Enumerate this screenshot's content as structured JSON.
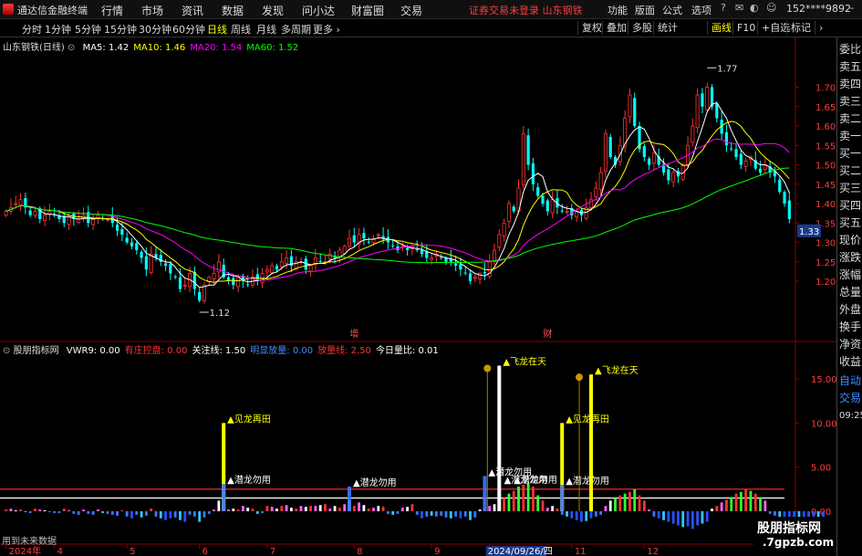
{
  "app": {
    "brand": "通达信金融终端",
    "menu": [
      "行情",
      "市场",
      "资讯",
      "数据",
      "发现",
      "问小达",
      "财富圈",
      "交易"
    ],
    "trade_warning": "证券交易未登录",
    "stock_title": "山东钢铁",
    "top_right": [
      "功能",
      "版面",
      "公式",
      "选项"
    ],
    "user": "152****9892"
  },
  "toolbar": {
    "periods": [
      "分时",
      "1分钟",
      "5分钟",
      "15分钟",
      "30分钟",
      "60分钟",
      "日线",
      "周线",
      "月线",
      "多周期",
      "更多"
    ],
    "active_period": "日线",
    "right_buttons": [
      "复权",
      "叠加",
      "多股",
      "统计",
      "画线",
      "F10",
      "+自选",
      "标记"
    ],
    "active_right": "画线"
  },
  "side_panel": {
    "items": [
      "委比",
      "卖五",
      "卖四",
      "卖三",
      "卖二",
      "卖一",
      "买一",
      "买二",
      "买三",
      "买四",
      "买五",
      "现价",
      "涨跌",
      "涨幅",
      "总量",
      "外盘",
      "换手",
      "净资",
      "收益"
    ],
    "extra": [
      "自动",
      "交易"
    ],
    "time": "09:25"
  },
  "main_legend": {
    "name": "山东钢铁(日线)",
    "items": [
      {
        "text": "MA5: 1.42",
        "color": "#ffffff"
      },
      {
        "text": "MA10: 1.46",
        "color": "#ffff00"
      },
      {
        "text": "MA20: 1.54",
        "color": "#ff00ff"
      },
      {
        "text": "MA60: 1.52",
        "color": "#00ff00"
      }
    ]
  },
  "indicator_legend": {
    "name": "股朋指标网",
    "items": [
      {
        "text": "VWR9: 0.00",
        "color": "#ffffff"
      },
      {
        "text": "有庄控盘: 0.00",
        "color": "#ff3232"
      },
      {
        "text": "关注线: 1.50",
        "color": "#ffffff"
      },
      {
        "text": "明显放量: 0.00",
        "color": "#3c8cff"
      },
      {
        "text": "放量线: 2.50",
        "color": "#ff3232"
      },
      {
        "text": "今日量比: 0.01",
        "color": "#ffffff"
      }
    ]
  },
  "chart_data": [
    {
      "type": "candlestick",
      "title": "山东钢铁(日线)",
      "y_ticks": [
        1.2,
        1.25,
        1.3,
        1.35,
        1.4,
        1.45,
        1.5,
        1.55,
        1.6,
        1.65,
        1.7
      ],
      "ylim": [
        1.08,
        1.8
      ],
      "current_price": "1.33",
      "max_label": "1.77",
      "min_label": "1.12",
      "markers": [
        {
          "text": "增",
          "at_index": 72
        },
        {
          "text": "财",
          "at_index": 112
        }
      ],
      "close": [
        1.38,
        1.39,
        1.4,
        1.41,
        1.39,
        1.37,
        1.38,
        1.36,
        1.37,
        1.38,
        1.37,
        1.36,
        1.35,
        1.37,
        1.36,
        1.36,
        1.37,
        1.35,
        1.36,
        1.37,
        1.36,
        1.36,
        1.35,
        1.33,
        1.32,
        1.3,
        1.29,
        1.28,
        1.26,
        1.23,
        1.27,
        1.26,
        1.25,
        1.24,
        1.22,
        1.21,
        1.18,
        1.19,
        1.22,
        1.18,
        1.15,
        1.19,
        1.21,
        1.22,
        1.25,
        1.21,
        1.2,
        1.19,
        1.21,
        1.2,
        1.19,
        1.21,
        1.2,
        1.22,
        1.23,
        1.24,
        1.23,
        1.25,
        1.26,
        1.24,
        1.25,
        1.25,
        1.23,
        1.24,
        1.26,
        1.25,
        1.25,
        1.27,
        1.26,
        1.28,
        1.29,
        1.31,
        1.3,
        1.32,
        1.31,
        1.3,
        1.31,
        1.32,
        1.31,
        1.3,
        1.29,
        1.28,
        1.29,
        1.28,
        1.29,
        1.28,
        1.27,
        1.26,
        1.26,
        1.27,
        1.26,
        1.25,
        1.25,
        1.24,
        1.23,
        1.22,
        1.2,
        1.21,
        1.22,
        1.22,
        1.25,
        1.28,
        1.32,
        1.35,
        1.4,
        1.38,
        1.44,
        1.58,
        1.5,
        1.45,
        1.42,
        1.4,
        1.38,
        1.41,
        1.39,
        1.38,
        1.38,
        1.37,
        1.38,
        1.37,
        1.39,
        1.41,
        1.44,
        1.48,
        1.58,
        1.52,
        1.5,
        1.55,
        1.62,
        1.68,
        1.6,
        1.54,
        1.52,
        1.5,
        1.53,
        1.5,
        1.48,
        1.46,
        1.48,
        1.47,
        1.5,
        1.55,
        1.6,
        1.68,
        1.65,
        1.7,
        1.65,
        1.62,
        1.58,
        1.55,
        1.54,
        1.52,
        1.5,
        1.51,
        1.52,
        1.49,
        1.48,
        1.5,
        1.48,
        1.47,
        1.43,
        1.4,
        1.36
      ],
      "series": [
        {
          "name": "MA5",
          "color": "#ffffff"
        },
        {
          "name": "MA10",
          "color": "#ffff00"
        },
        {
          "name": "MA20",
          "color": "#ff00ff"
        },
        {
          "name": "MA60",
          "color": "#00ff00"
        }
      ]
    },
    {
      "type": "bar",
      "title": "股朋指标网",
      "y_ticks": [
        0.0,
        5.0,
        10.0,
        15.0
      ],
      "ylim": [
        -3,
        18
      ],
      "ref_lines": [
        {
          "value": 1.5,
          "color": "#ffffff"
        },
        {
          "value": 2.5,
          "color": "#ff3232"
        }
      ],
      "bars": [
        0.2,
        0.3,
        0.1,
        0.2,
        -0.1,
        -0.2,
        0.3,
        0.2,
        0.1,
        -0.1,
        -0.2,
        -0.2,
        0.3,
        0.1,
        -0.3,
        -0.4,
        0.2,
        -0.3,
        -0.4,
        0.2,
        -0.2,
        -0.3,
        -0.4,
        -0.5,
        0.1,
        -0.6,
        -0.8,
        -0.4,
        -0.7,
        -0.5,
        0.3,
        -0.6,
        -0.8,
        -1,
        -0.8,
        -0.7,
        -1,
        -1.2,
        -0.4,
        -0.6,
        -1.2,
        -0.7,
        -0.3,
        0.2,
        1.2,
        0.4,
        0.2,
        0.3,
        0.2,
        0.6,
        0.4,
        0.3,
        -0.3,
        -0.2,
        0.6,
        0.5,
        0.3,
        0.6,
        0.7,
        0.4,
        0.3,
        0.6,
        0.5,
        0.6,
        0.6,
        0.7,
        0.8,
        0.3,
        0.6,
        0.4,
        0.8,
        1.2,
        0.6,
        1,
        0.7,
        0.3,
        0.4,
        0.6,
        0.5,
        -0.3,
        -0.4,
        -0.3,
        0.4,
        0.5,
        0.8,
        -0.4,
        -0.8,
        -0.6,
        -0.5,
        -0.6,
        -0.5,
        -0.7,
        -0.8,
        -0.6,
        -0.8,
        -0.6,
        -1,
        -0.7,
        0.2,
        0.4,
        0.6,
        0.8,
        1.2,
        1.5,
        2,
        2.3,
        2.8,
        3,
        3.2,
        2.8,
        1.8,
        1.2,
        0.4,
        0.6,
        0.3,
        -0.4,
        -0.6,
        -0.8,
        -1,
        -1.2,
        -1.1,
        -0.8,
        -0.6,
        -0.4,
        0.6,
        1.2,
        1.5,
        1.8,
        2,
        2.2,
        2.5,
        1.8,
        1.2,
        0.2,
        -0.6,
        -0.8,
        -1,
        -1.2,
        -1.4,
        -1.6,
        -1.8,
        -1.7,
        -2,
        -1.6,
        -1.4,
        -1.2,
        0.3,
        0.6,
        1,
        1.3,
        1.6,
        2,
        2.2,
        2.5,
        2.3,
        2,
        1.6,
        1.2,
        -0.3,
        -0.5,
        -0.8,
        -1,
        -1.2,
        -1.3,
        -1.2,
        -1.4,
        -1.5,
        -1.4,
        -1.6,
        -1.7
      ],
      "signals": [
        {
          "text": "见龙再田",
          "at_index": 45,
          "height": 10,
          "color": "#ffff00"
        },
        {
          "text": "潜龙勿用",
          "at_index": 45,
          "height": 3.1,
          "color": "#3c78ff"
        },
        {
          "text": "潜龙勿用",
          "at_index": 71,
          "height": 2.8,
          "color": "#3c78ff"
        },
        {
          "text": "飞龙在天",
          "at_index": 102,
          "height": 16.5,
          "color": "#ffffff"
        },
        {
          "text": "潜龙勿用",
          "at_index": 99,
          "height": 4,
          "color": "#3c78ff"
        },
        {
          "text": "见龙再田",
          "at_index": 115,
          "height": 10,
          "color": "#ffff00"
        },
        {
          "text": "潜龙勿用",
          "at_index": 115,
          "height": 3,
          "color": "#3c78ff"
        },
        {
          "text": "飞龙在天",
          "at_index": 121,
          "height": 15.5,
          "color": "#ffff00"
        }
      ],
      "overlap_labels": [
        {
          "text": "潜龙勿用",
          "at_index": 103
        },
        {
          "text": "潜龙勿用",
          "at_index": 105
        }
      ]
    }
  ],
  "x_axis": {
    "ticks": [
      {
        "text": "2024年",
        "at_index": 0
      },
      {
        "text": "4",
        "at_index": 10
      },
      {
        "text": "5",
        "at_index": 25
      },
      {
        "text": "6",
        "at_index": 40
      },
      {
        "text": "7",
        "at_index": 54
      },
      {
        "text": "8",
        "at_index": 72
      },
      {
        "text": "9",
        "at_index": 88
      },
      {
        "text": "2024/09/26/四",
        "at_index": 100
      },
      {
        "text": "11",
        "at_index": 117
      },
      {
        "text": "12",
        "at_index": 132
      }
    ],
    "highlight": "2024/09/26/四"
  },
  "future_data": "用到未来数据",
  "watermark": {
    "line1": "股朋指标网",
    "line2": ".7gpzb.com"
  }
}
